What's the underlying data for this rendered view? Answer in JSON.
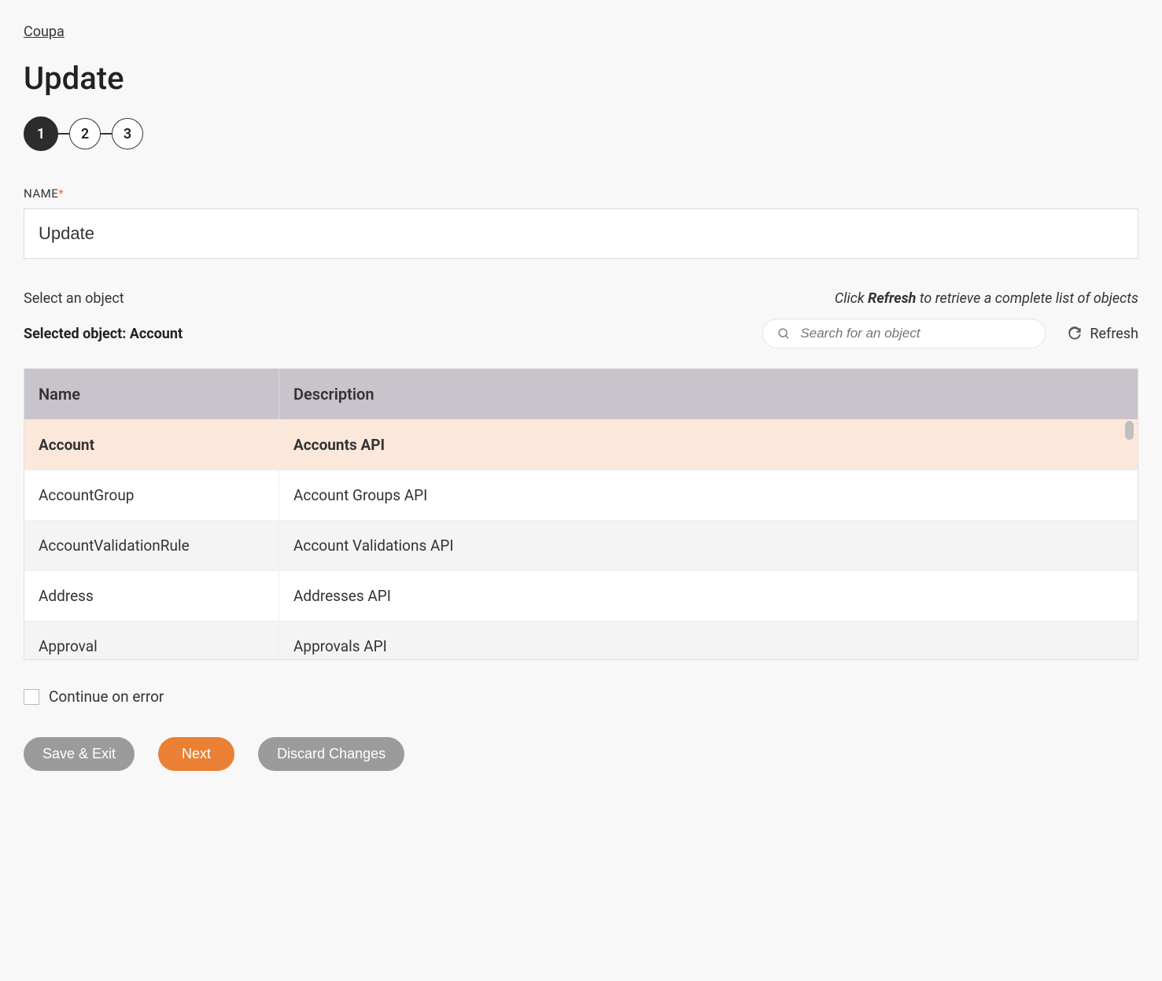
{
  "breadcrumb": "Coupa",
  "page_title": "Update",
  "stepper": {
    "steps": [
      "1",
      "2",
      "3"
    ],
    "active_index": 0
  },
  "name_field": {
    "label": "NAME",
    "value": "Update"
  },
  "object_select": {
    "prompt": "Select an object",
    "hint_prefix": "Click ",
    "hint_bold": "Refresh",
    "hint_suffix": " to retrieve a complete list of objects",
    "selected_prefix": "Selected object: ",
    "selected_value": "Account",
    "search_placeholder": "Search for an object",
    "refresh_label": "Refresh"
  },
  "table": {
    "headers": {
      "name": "Name",
      "description": "Description"
    },
    "rows": [
      {
        "name": "Account",
        "description": "Accounts API",
        "selected": true
      },
      {
        "name": "AccountGroup",
        "description": "Account Groups API"
      },
      {
        "name": "AccountValidationRule",
        "description": "Account Validations API"
      },
      {
        "name": "Address",
        "description": "Addresses API"
      },
      {
        "name": "Approval",
        "description": "Approvals API"
      }
    ]
  },
  "continue_on_error": {
    "label": "Continue on error",
    "checked": false
  },
  "buttons": {
    "save_exit": "Save & Exit",
    "next": "Next",
    "discard": "Discard Changes"
  }
}
